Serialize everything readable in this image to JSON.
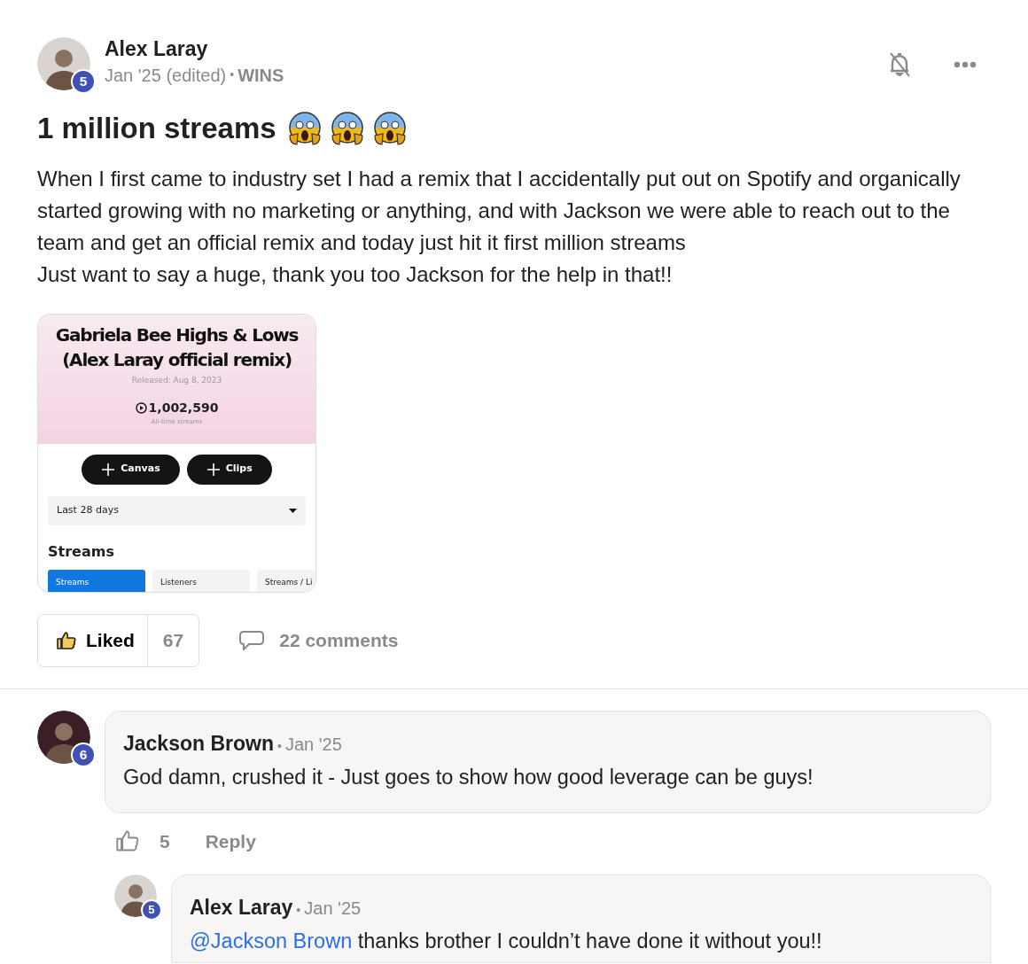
{
  "post": {
    "author": "Alex Laray",
    "level": "5",
    "date": "Jan '25 (edited)",
    "separator": "•",
    "category": "WINS",
    "title": "1 million streams",
    "paragraphs": [
      "When I first came to industry set I had a remix that I accidentally put out on Spotify and organically started growing with no marketing or anything, and with Jackson we were able to reach out to the team and get an official remix and today just hit it first million streams",
      "Just want to say a huge, thank you too Jackson for the help in that!!"
    ],
    "attachment": {
      "title_lines": [
        "Gabriela Bee Highs & Lows",
        "(Alex Laray official remix)"
      ],
      "released": "Released: Aug 8, 2023",
      "streams": "1,002,590",
      "streams_label": "All-time streams",
      "buttons": [
        "Canvas",
        "Clips"
      ],
      "range": "Last 28 days",
      "section": "Streams",
      "tabs": [
        {
          "label": "Streams",
          "selected": true
        },
        {
          "label": "Listeners",
          "selected": false
        },
        {
          "label": "Streams / Li",
          "selected": false
        }
      ]
    },
    "like": {
      "label": "Liked",
      "count": "67",
      "liked": true
    },
    "comments_link": "22 comments"
  },
  "comments": [
    {
      "author": "Jackson Brown",
      "level": "6",
      "separator": "•",
      "date": "Jan '25",
      "text": "God damn, crushed it - Just goes to show how good leverage can be guys!",
      "likes": "5",
      "reply": "Reply",
      "replies": [
        {
          "author": "Alex Laray",
          "level": "5",
          "separator": "•",
          "date": "Jan '25",
          "mention": "@Jackson Brown",
          "text": "thanks brother I couldn’t have done it without you!!"
        }
      ]
    }
  ]
}
